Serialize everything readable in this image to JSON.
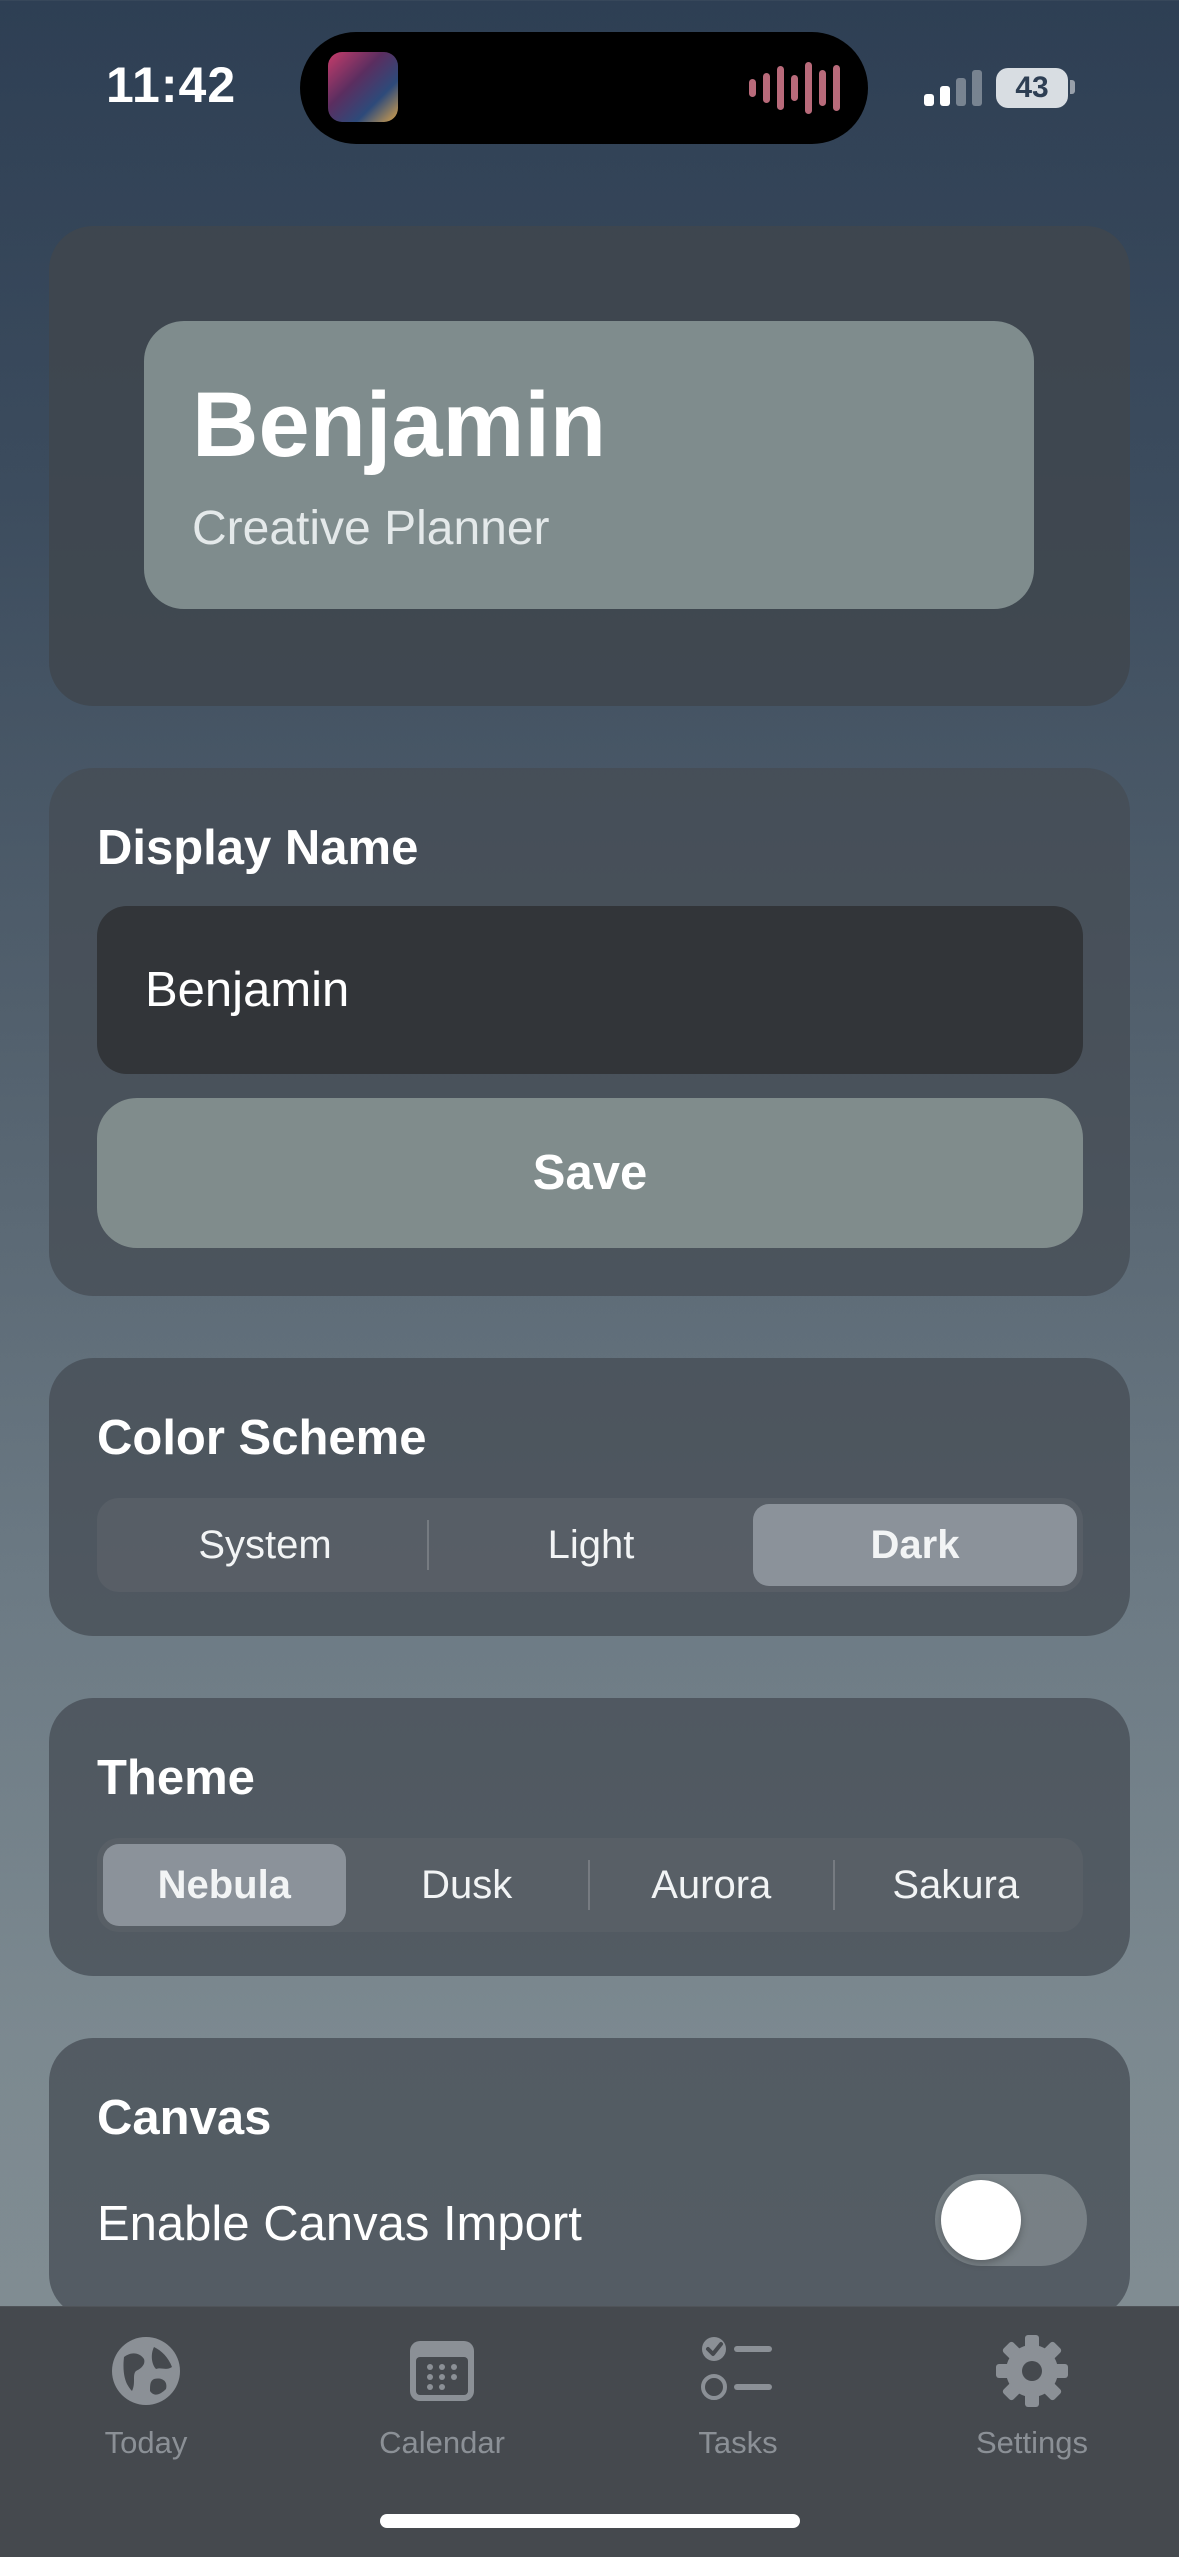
{
  "status_bar": {
    "time": "11:42",
    "battery": "43"
  },
  "profile": {
    "name": "Benjamin",
    "subtitle": "Creative Planner"
  },
  "display_name": {
    "title": "Display Name",
    "value": "Benjamin",
    "save_label": "Save"
  },
  "color_scheme": {
    "title": "Color Scheme",
    "options": [
      "System",
      "Light",
      "Dark"
    ],
    "selected": "Dark"
  },
  "theme": {
    "title": "Theme",
    "options": [
      "Nebula",
      "Dusk",
      "Aurora",
      "Sakura"
    ],
    "selected": "Nebula"
  },
  "canvas": {
    "title": "Canvas",
    "toggle_label": "Enable Canvas Import",
    "enabled": false
  },
  "tabbar": {
    "items": [
      {
        "label": "Today",
        "icon": "globe-icon"
      },
      {
        "label": "Calendar",
        "icon": "calendar-icon"
      },
      {
        "label": "Tasks",
        "icon": "checklist-icon"
      },
      {
        "label": "Settings",
        "icon": "gear-icon"
      }
    ]
  },
  "colors": {
    "accent_button": "#808c8c",
    "input_bg": "#323539",
    "tab_inactive": "#8b9096"
  }
}
